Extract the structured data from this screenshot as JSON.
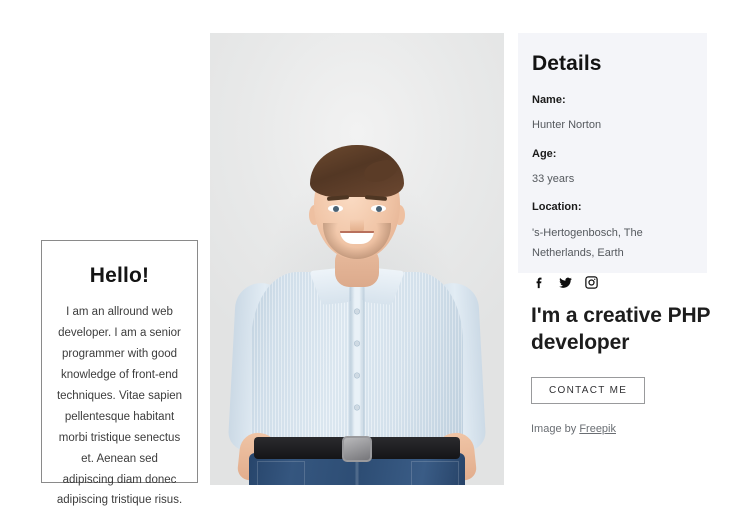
{
  "hello_card": {
    "title": "Hello!",
    "body": "I am an allround web developer. I am a senior programmer with good knowledge of front-end techniques. Vitae sapien pellentesque habitant morbi tristique senectus et. Aenean sed adipiscing diam donec adipiscing tristique risus."
  },
  "photo": {
    "alt": "Smiling young man in a light blue striped shirt and blue jeans, hands in pockets, standing against a light gray background",
    "background_color": "#ebebeb",
    "shirt_color": "#dbe7f1",
    "jeans_color": "#2f527b",
    "belt_color": "#1b1b1d",
    "hair_color": "#5b3c27",
    "skin_color": "#f1c6a8"
  },
  "details": {
    "title": "Details",
    "panel_background": "#f4f5f9",
    "fields": [
      {
        "label": "Name:",
        "value": "Hunter Norton"
      },
      {
        "label": "Age:",
        "value": "33 years"
      },
      {
        "label": "Location:",
        "value": "'s-Hertogenbosch, The Netherlands, Earth"
      }
    ],
    "socials": [
      {
        "icon": "facebook-icon",
        "name": "Facebook"
      },
      {
        "icon": "twitter-icon",
        "name": "Twitter"
      },
      {
        "icon": "instagram-icon",
        "name": "Instagram"
      }
    ]
  },
  "promo": {
    "title": "I'm a creative PHP developer",
    "button_label": "CONTACT ME",
    "credit_prefix": "Image by ",
    "credit_link": "Freepik"
  }
}
